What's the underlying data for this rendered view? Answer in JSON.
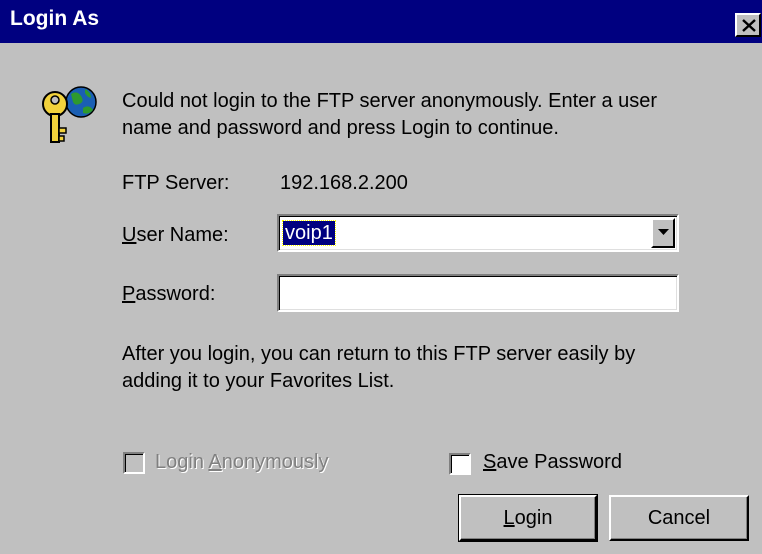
{
  "window": {
    "title": "Login As",
    "close_icon": "close-icon"
  },
  "icon": "key-globe-icon",
  "message": "Could not login to the FTP server anonymously.  Enter a user name and password and press Login to continue.",
  "server": {
    "label": "FTP Server:",
    "value": "192.168.2.200"
  },
  "username": {
    "label_accel": "U",
    "label_rest": "ser Name:",
    "value": "voip1"
  },
  "password": {
    "label_accel": "P",
    "label_rest": "assword:",
    "value": ""
  },
  "info": "After you login, you can return to this FTP server easily by adding it to your Favorites List.",
  "options": {
    "anonymous_accel": "Login ",
    "anonymous_under": "A",
    "anonymous_rest": "nonymously",
    "anonymous_checked": false,
    "anonymous_enabled": false,
    "save_accel": "S",
    "save_rest": "ave Password",
    "save_checked": false
  },
  "buttons": {
    "login_accel": "L",
    "login_rest": "ogin",
    "cancel": "Cancel"
  }
}
